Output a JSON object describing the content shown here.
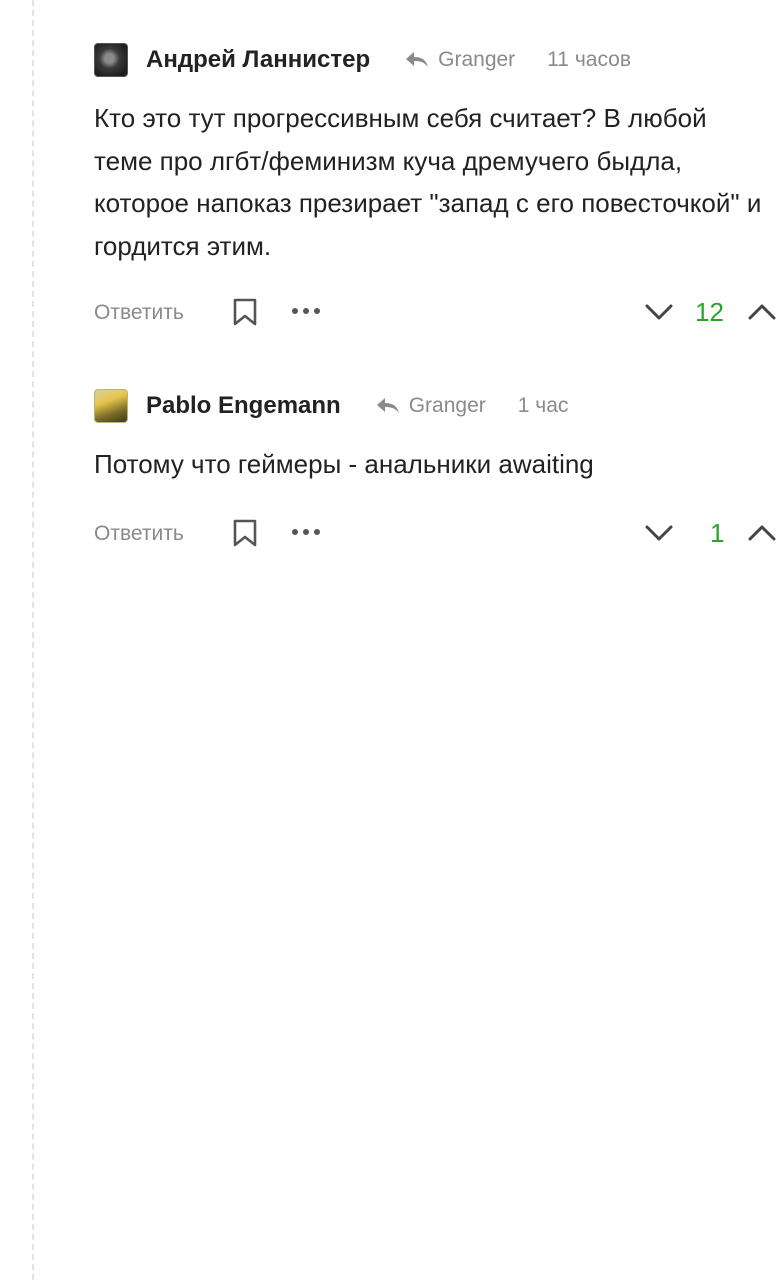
{
  "comments": [
    {
      "author": "Андрей Ланнистер",
      "reply_to": "Granger",
      "time": "11 часов",
      "paragraphs": [
        "Кто это тут прогрессивным себя считает? В любой теме про лгбт/феминизм куча дремучего быдла, которое напоказ презирает \"запад с его повесточкой\" и гордится этим."
      ],
      "reply_label": "Ответить",
      "score": "12"
    },
    {
      "author": "Pablo Engemann",
      "reply_to": "Granger",
      "time": "1 час",
      "paragraphs": [
        "Потому что геймеры - анальники awaiting",
        "",
        ""
      ],
      "reply_label": "Ответить",
      "score": "1"
    }
  ],
  "colors": {
    "score": "#2aa52a",
    "muted": "#8a8a8a",
    "text": "#222222"
  },
  "icons": [
    "reply-arrow-icon",
    "bookmark-icon",
    "more-dots-icon",
    "chevron-down-icon",
    "chevron-up-icon"
  ]
}
